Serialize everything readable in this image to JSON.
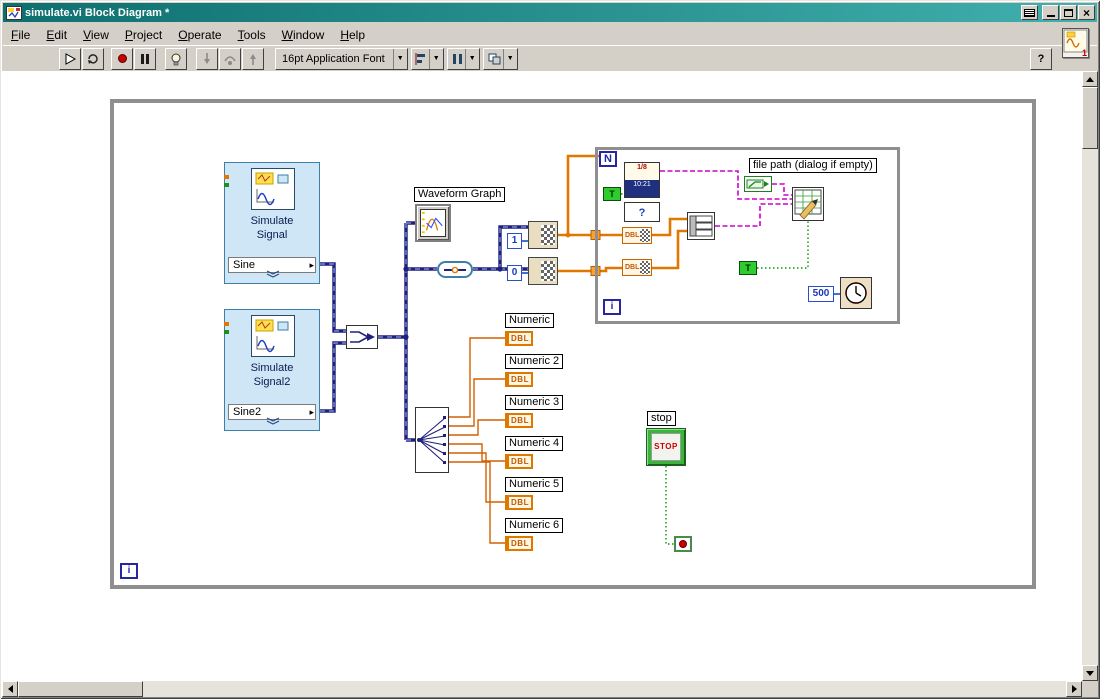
{
  "window": {
    "title": "simulate.vi Block Diagram *"
  },
  "menu": {
    "items": [
      "File",
      "Edit",
      "View",
      "Project",
      "Operate",
      "Tools",
      "Window",
      "Help"
    ]
  },
  "toolbar": {
    "font_selector": "16pt Application Font",
    "help_label": "?",
    "vi_icon_badge": "1"
  },
  "icons": {
    "dropdown_arrow": "▼",
    "close": "×",
    "output_arrow": "▸"
  },
  "diagram": {
    "while_loop": {
      "counter": "i"
    },
    "for_loop": {
      "count_label": "N",
      "counter": "i"
    },
    "simulate_signal_1": {
      "title": "Simulate Signal",
      "output": "Sine"
    },
    "simulate_signal_2": {
      "title": "Simulate Signal2",
      "output": "Sine2"
    },
    "waveform_graph_label": "Waveform Graph",
    "const_one": "1",
    "const_zero": "0",
    "dbl_label": "DBL",
    "datetime_icon": {
      "date": "1/8",
      "time": "10:21"
    },
    "file_dialog_mark": "?",
    "file_path_label": "file path (dialog if empty)",
    "bool_true": "T",
    "wait_ms": "500",
    "numerics": [
      {
        "label": "Numeric",
        "type": "DBL"
      },
      {
        "label": "Numeric 2",
        "type": "DBL"
      },
      {
        "label": "Numeric 3",
        "type": "DBL"
      },
      {
        "label": "Numeric 4",
        "type": "DBL"
      },
      {
        "label": "Numeric 5",
        "type": "DBL"
      },
      {
        "label": "Numeric 6",
        "type": "DBL"
      }
    ],
    "stop": {
      "label": "stop",
      "button_text": "STOP"
    }
  },
  "colors": {
    "titlebar-start": "#0e6f6f",
    "titlebar-end": "#41b0ae",
    "chrome": "#d4d0c8",
    "canvas": "#ffffff",
    "loop-border": "#8f8f8f",
    "express-bg": "#cfe6f7",
    "express-border": "#3f7ea6",
    "wire-dynamic": "#20207a",
    "wire-dynamic-dash": "#7f9fe8",
    "wire-dbl": "#e07800",
    "wire-dbl-thin": "#d06000",
    "wire-string": "#cc00cc",
    "wire-bool": "#009900",
    "wire-int": "#0040c0",
    "bool-green": "#2ecc2e",
    "stop-red": "#cc0000"
  }
}
